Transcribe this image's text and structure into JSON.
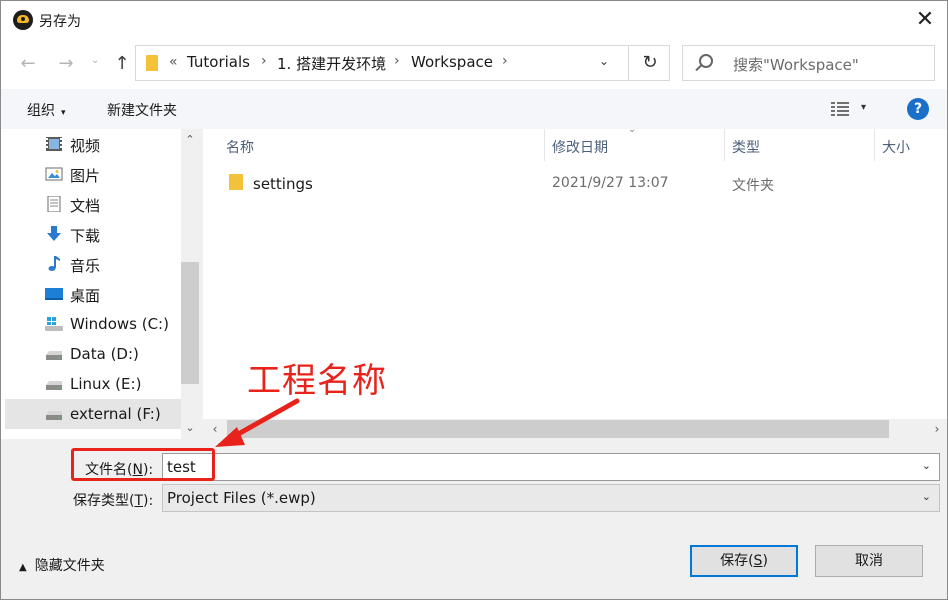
{
  "window": {
    "title": "另存为",
    "close_glyph": "✕"
  },
  "nav": {
    "back_glyph": "←",
    "forward_glyph": "→",
    "dropdown_glyph": "⌄",
    "up_glyph": "↑",
    "address": {
      "overflow_glyph": "«",
      "crumbs": [
        "Tutorials",
        "1. 搭建开发环境",
        "Workspace"
      ],
      "sep_glyph": "›",
      "dropdown_glyph": "⌄",
      "refresh_glyph": "↻"
    },
    "search_placeholder": "搜索\"Workspace\""
  },
  "toolbar": {
    "organize": "组织",
    "caret": "▾",
    "new_folder": "新建文件夹",
    "view_dropdown": "▾",
    "help": "?"
  },
  "sidebar": {
    "items": [
      {
        "label": "视频",
        "icon": "video-icon"
      },
      {
        "label": "图片",
        "icon": "pictures-icon"
      },
      {
        "label": "文档",
        "icon": "documents-icon"
      },
      {
        "label": "下载",
        "icon": "downloads-icon"
      },
      {
        "label": "音乐",
        "icon": "music-icon"
      },
      {
        "label": "桌面",
        "icon": "desktop-icon"
      },
      {
        "label": "Windows (C:)",
        "icon": "windows-drive-icon"
      },
      {
        "label": "Data (D:)",
        "icon": "drive-icon"
      },
      {
        "label": "Linux (E:)",
        "icon": "drive-icon"
      },
      {
        "label": "external (F:)",
        "icon": "drive-icon",
        "selected": true
      }
    ],
    "scroll_up": "⌃",
    "scroll_down": "⌄"
  },
  "filelist": {
    "columns": [
      "名称",
      "修改日期",
      "类型",
      "大小"
    ],
    "sort_caret": "⌄",
    "rows": [
      {
        "name": "settings",
        "date": "2021/9/27 13:07",
        "type": "文件夹"
      }
    ],
    "hscroll_left": "‹",
    "hscroll_right": "›"
  },
  "form": {
    "filename_label": "文件名(",
    "filename_key": "N",
    "filename_label_end": "):",
    "filename_value": "test",
    "filetype_label": "保存类型(",
    "filetype_key": "T",
    "filetype_label_end": "):",
    "filetype_value": "Project Files (*.ewp)",
    "dd_glyph": "⌄"
  },
  "footer": {
    "hide_folders": "隐藏文件夹",
    "hide_caret": "▲",
    "save_label": "保存(",
    "save_key": "S",
    "save_end": ")",
    "cancel": "取消"
  },
  "annotation": {
    "text": "工程名称",
    "color": "#e8231b"
  },
  "colors": {
    "accent": "#0078d7",
    "help": "#1a70c9",
    "folder": "#f3c13a",
    "header_text": "#4c607a"
  }
}
